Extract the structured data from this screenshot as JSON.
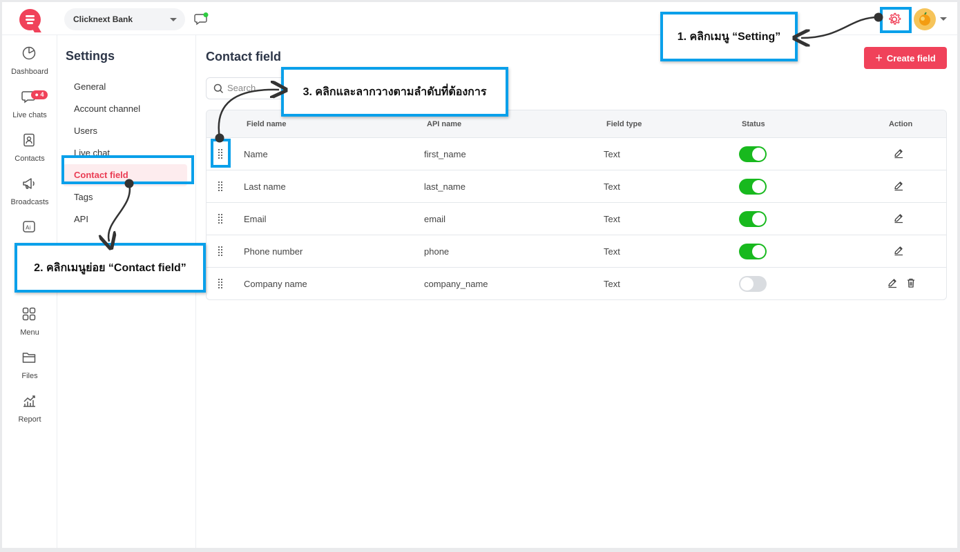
{
  "topbar": {
    "org_name": "Clicknext Bank"
  },
  "rail": {
    "items": [
      {
        "label": "Dashboard",
        "icon": "pie-chart-icon"
      },
      {
        "label": "Live chats",
        "icon": "chat-icon",
        "badge": "4"
      },
      {
        "label": "Contacts",
        "icon": "contact-book-icon"
      },
      {
        "label": "Broadcasts",
        "icon": "megaphone-icon"
      },
      {
        "label": "",
        "icon": "ai-icon"
      },
      {
        "label": "Menu",
        "icon": "grid-icon"
      },
      {
        "label": "Files",
        "icon": "folder-icon"
      },
      {
        "label": "Report",
        "icon": "chart-icon"
      }
    ]
  },
  "settings": {
    "title": "Settings",
    "items": [
      {
        "label": "General"
      },
      {
        "label": "Account channel"
      },
      {
        "label": "Users"
      },
      {
        "label": "Live chat"
      },
      {
        "label": "Contact field",
        "active": true
      },
      {
        "label": "Tags"
      },
      {
        "label": "API"
      }
    ]
  },
  "main": {
    "title": "Contact field",
    "create_label": "Create field",
    "search_placeholder": "Search",
    "columns": [
      "Field name",
      "API name",
      "Field type",
      "Status",
      "Action"
    ],
    "rows": [
      {
        "field_name": "Name",
        "api_name": "first_name",
        "field_type": "Text",
        "status": true
      },
      {
        "field_name": "Last name",
        "api_name": "last_name",
        "field_type": "Text",
        "status": true
      },
      {
        "field_name": "Email",
        "api_name": "email",
        "field_type": "Text",
        "status": true
      },
      {
        "field_name": "Phone number",
        "api_name": "phone",
        "field_type": "Text",
        "status": true
      },
      {
        "field_name": "Company name",
        "api_name": "company_name",
        "field_type": "Text",
        "status": false
      }
    ]
  },
  "annotations": {
    "step1": "1. คลิกเมนู “Setting”",
    "step2": "2. คลิกเมนูย่อย “Contact field”",
    "step3": "3. คลิกและลากวางตามลำดับที่ต้องการ"
  },
  "colors": {
    "brand": "#f0425a",
    "accent": "#0aa0ea",
    "toggle_on": "#18b91e"
  }
}
